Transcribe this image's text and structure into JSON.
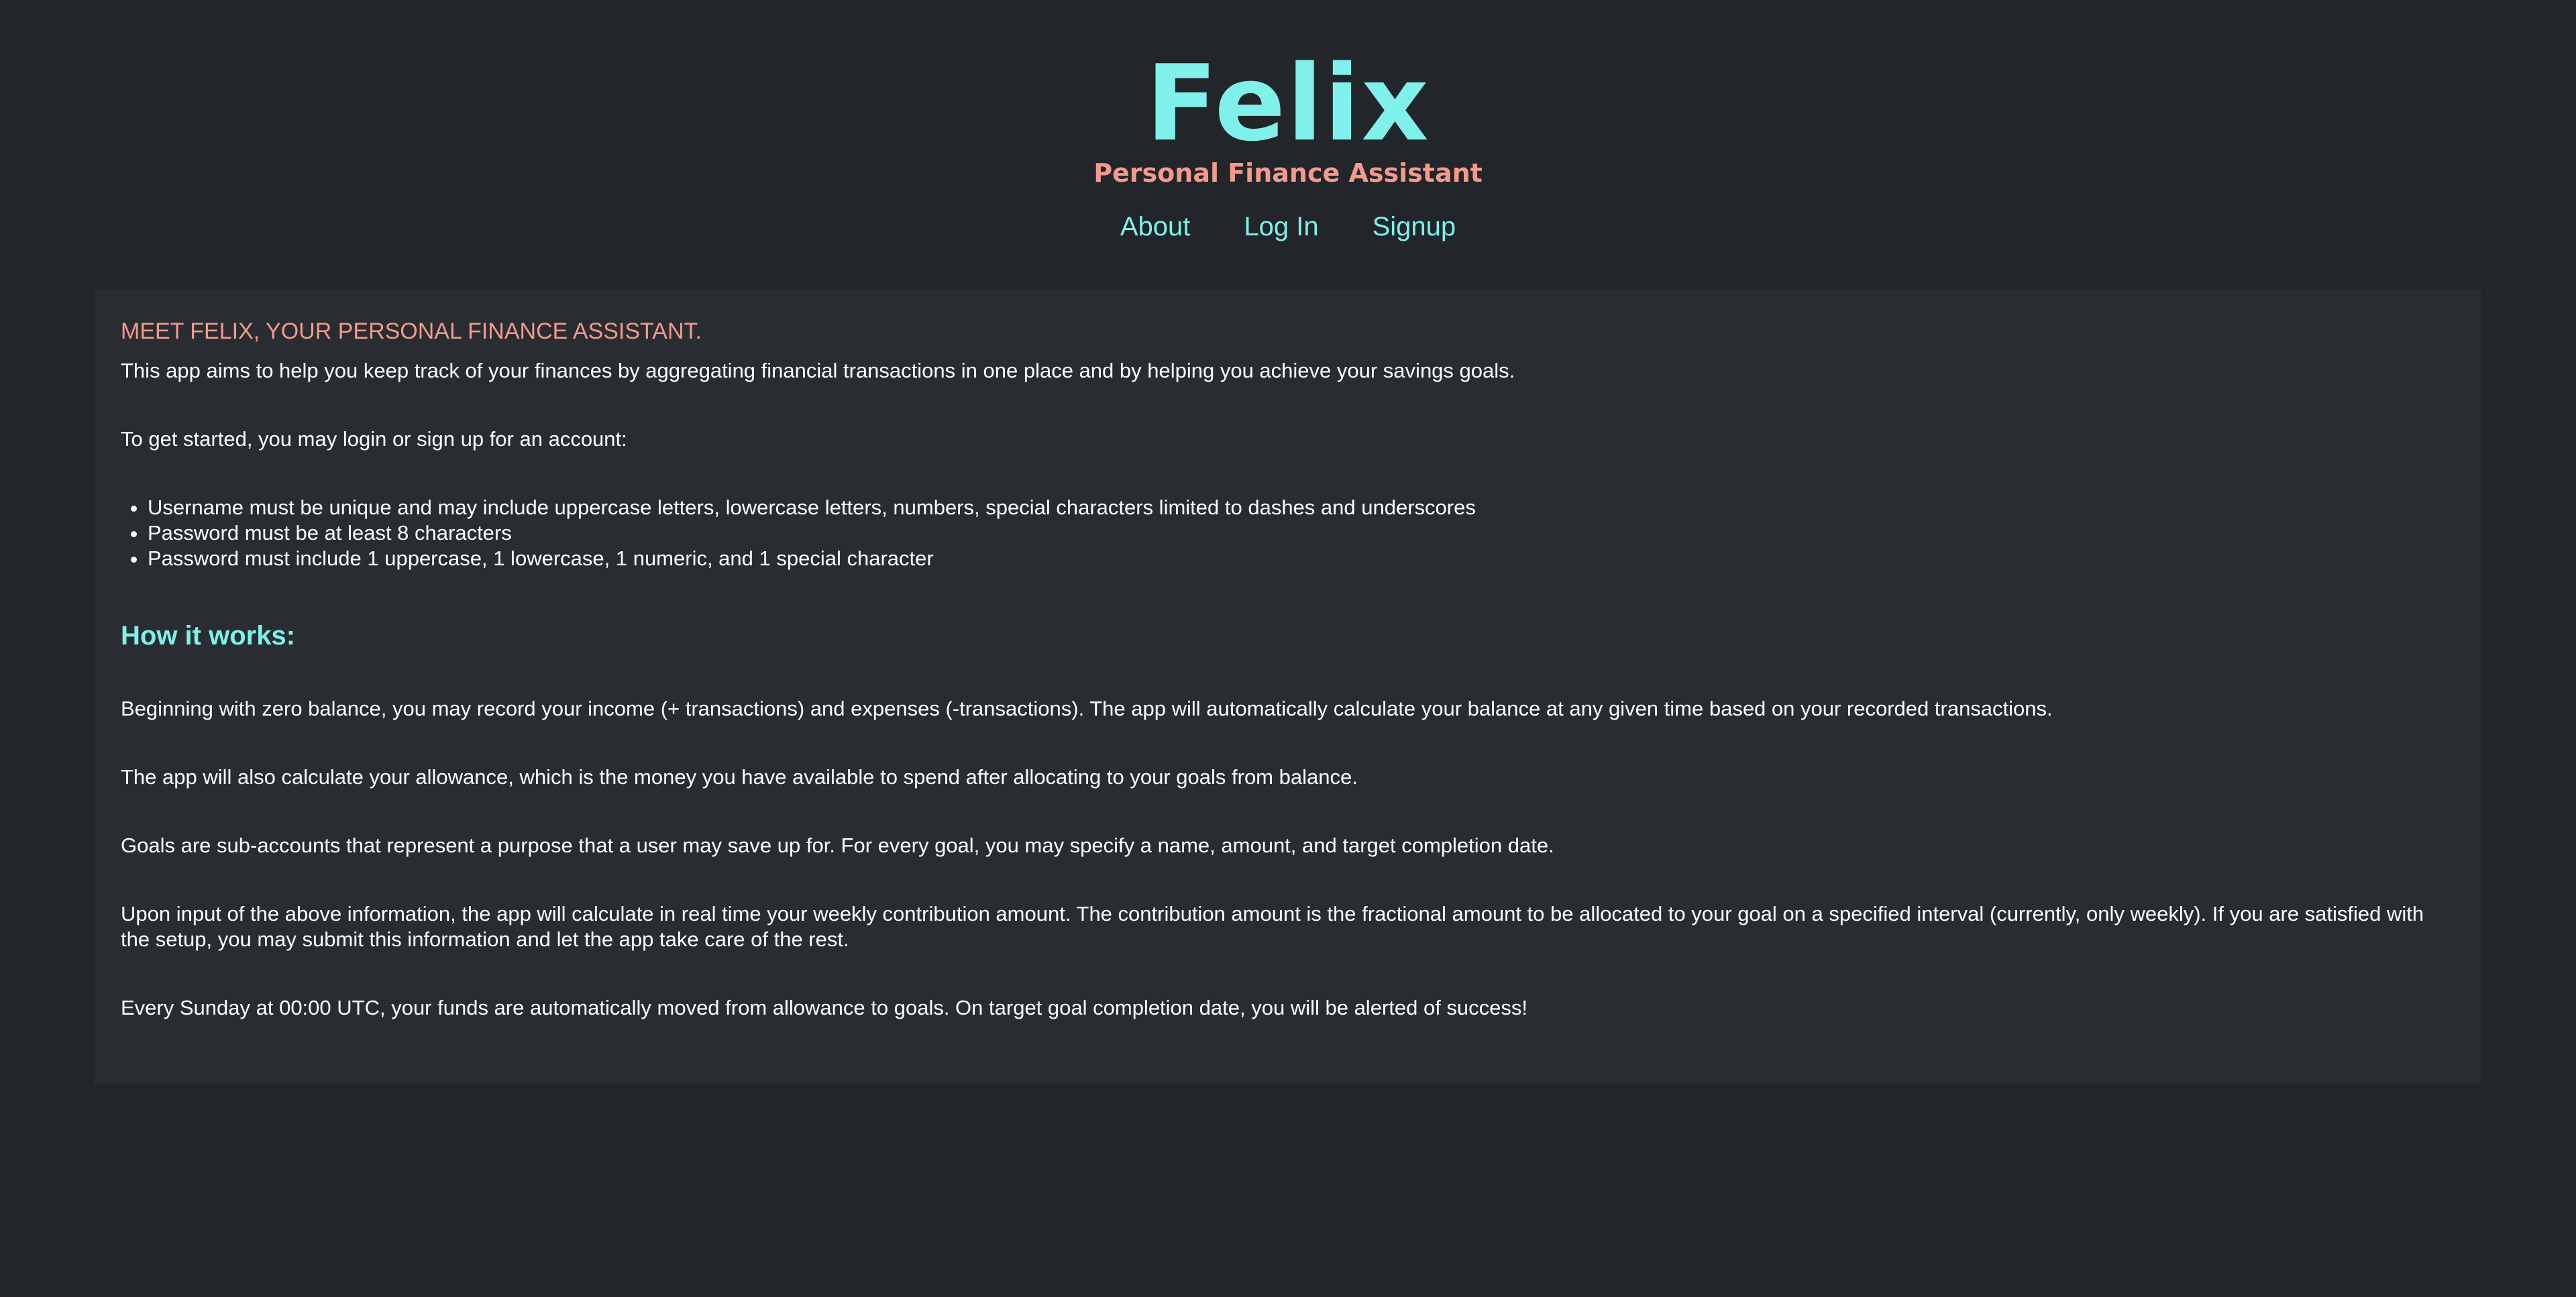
{
  "brand": {
    "name": "Felix",
    "tagline": "Personal Finance Assistant"
  },
  "nav": {
    "about": "About",
    "login": "Log In",
    "signup": "Signup"
  },
  "intro": {
    "title": "MEET FELIX, YOUR PERSONAL FINANCE ASSISTANT.",
    "aim": "This app aims to help you keep track of your finances by aggregating financial transactions in one place and by helping you achieve your savings goals.",
    "get_started": "To get started, you may login or sign up for an account:",
    "rules": [
      "Username must be unique and may include uppercase letters, lowercase letters, numbers, special characters limited to dashes and underscores",
      "Password must be at least 8 characters",
      "Password must include 1 uppercase, 1 lowercase, 1 numeric, and 1 special character"
    ]
  },
  "how_it_works": {
    "heading": "How it works:",
    "paragraphs": [
      "Beginning with zero balance, you may record your income (+ transactions) and expenses (-transactions). The app will automatically calculate your balance at any given time based on your recorded transactions.",
      "The app will also calculate your allowance, which is the money you have available to spend after allocating to your goals from balance.",
      "Goals are sub-accounts that represent a purpose that a user may save up for. For every goal, you may specify a name, amount, and target completion date.",
      "Upon input of the above information, the app will calculate in real time your weekly contribution amount. The contribution amount is the fractional amount to be allocated to your goal on a specified interval (currently, only weekly). If you are satisfied with the setup, you may submit this information and let the app take care of the rest.",
      "Every Sunday at 00:00 UTC, your funds are automatically moved from allowance to goals. On target goal completion date, you will be alerted of success!"
    ]
  },
  "colors": {
    "background": "#222529",
    "card": "#292d31",
    "accent_cyan": "#7ff0ea",
    "accent_salmon": "#f39a8c",
    "text": "#ffffff"
  }
}
